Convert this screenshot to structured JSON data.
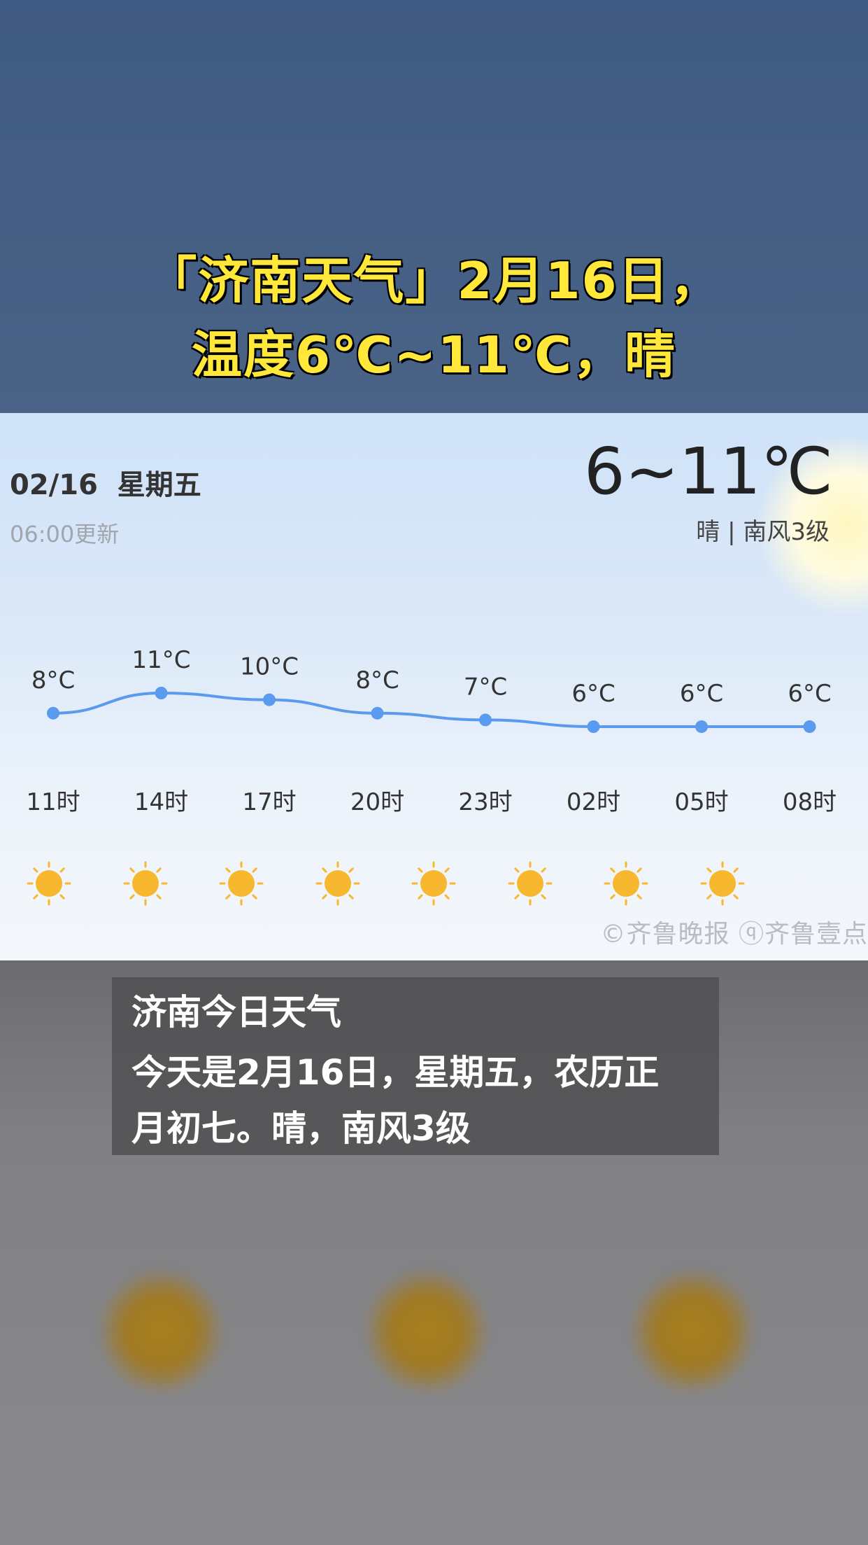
{
  "headline": {
    "line1": "「济南天气」2月16日，",
    "line2": "温度6℃~11℃，晴"
  },
  "card": {
    "date": "02/16  星期五",
    "update": "06:00更新",
    "temp_range": "6~11℃",
    "condition": "晴 | 南风3级",
    "watermark": "©齐鲁晚报 ⓠ齐鲁壹点"
  },
  "chart_data": {
    "type": "line",
    "x": [
      "11时",
      "14时",
      "17时",
      "20时",
      "23时",
      "02时",
      "05时",
      "08时"
    ],
    "values": [
      8,
      11,
      10,
      8,
      7,
      6,
      6,
      6
    ],
    "labels": [
      "8°C",
      "11°C",
      "10°C",
      "8°C",
      "7°C",
      "6°C",
      "6°C",
      "6°C"
    ],
    "unit": "°C",
    "line_color": "#5b9bef",
    "icons": [
      "sun-icon",
      "sun-icon",
      "sun-icon",
      "sun-icon",
      "sun-icon",
      "sun-icon",
      "sun-icon",
      "sun-icon"
    ],
    "icon_color": "#f7b72e"
  },
  "subtitle": {
    "line1": "济南今日天气",
    "line2": "今天是2月16日，星期五，农历正",
    "line3": "月初七。晴，南风3级"
  }
}
